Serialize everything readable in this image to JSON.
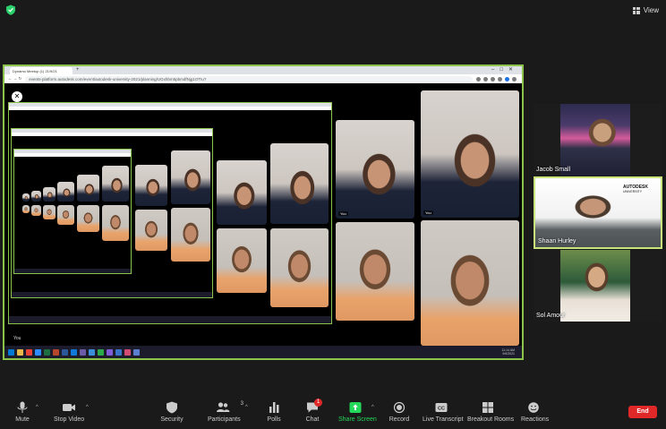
{
  "header": {
    "view_label": "View",
    "shield_color": "#2bd26b"
  },
  "share": {
    "tab_title": "Dynamo Meetup (1) 21/9/21",
    "url": "events-platform.autodesk.com/event/autodesk-university-2021/planning/UGxhbm5pbmdfNjg1OTIu?",
    "tile_label": "You",
    "self_label": "You",
    "clock": {
      "time": "11:14 AM",
      "date": "9/9/2021"
    }
  },
  "participants": [
    {
      "name": "Jacob Small",
      "speaking": false
    },
    {
      "name": "Shaan Hurley",
      "speaking": true,
      "logo": "AUTODESK",
      "logo_sub": "UNIVERSITY"
    },
    {
      "name": "Sol Amour",
      "speaking": false
    }
  ],
  "toolbar": {
    "mute": "Mute",
    "stop_video": "Stop Video",
    "security": "Security",
    "participants": "Participants",
    "participants_count": "3",
    "polls": "Polls",
    "chat": "Chat",
    "chat_badge": "1",
    "share_screen": "Share Screen",
    "record": "Record",
    "live_transcript": "Live Transcript",
    "breakout_rooms": "Breakout Rooms",
    "reactions": "Reactions",
    "end": "End",
    "caret": "^",
    "colors": {
      "share_green": "#23d959",
      "end_red": "#e02828",
      "accent_green": "#8bc34a"
    }
  }
}
